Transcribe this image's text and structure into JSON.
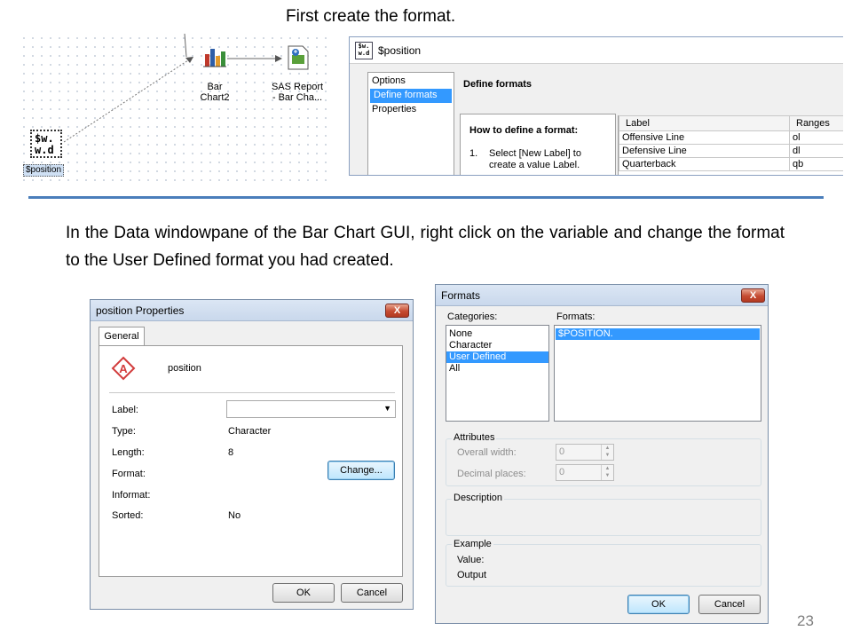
{
  "captions": {
    "top": "First create the format.",
    "middle": "In the Data windowpane of the Bar Chart GUI, right click on the variable and change the format to the User Defined format you had created."
  },
  "flow": {
    "node_format_icon_text": "$w.\nw.d",
    "node_format_label": "$position",
    "node_bar_label": "Bar\nChart2",
    "node_report_label": "SAS Report\n- Bar Cha..."
  },
  "format_window": {
    "title": "$position",
    "icon_text": "$w.\nw.d",
    "nav_items": [
      "Options",
      "Define formats",
      "Properties"
    ],
    "nav_selected": 1,
    "section_title": "Define formats",
    "howto_title": "How to define a format:",
    "howto_step_num": "1.",
    "howto_step_text": "Select [New Label] to\ncreate a value Label.",
    "grid_headers": [
      "Label",
      "Ranges"
    ],
    "grid_rows": [
      [
        "Offensive Line",
        "ol"
      ],
      [
        "Defensive Line",
        "dl"
      ],
      [
        "Quarterback",
        "qb"
      ]
    ]
  },
  "properties_dialog": {
    "title": "position Properties",
    "close_glyph": "X",
    "tab": "General",
    "var_name": "position",
    "fields": [
      {
        "label": "Label:",
        "value": ""
      },
      {
        "label": "Type:",
        "value": "Character"
      },
      {
        "label": "Length:",
        "value": "8"
      },
      {
        "label": "Format:",
        "value": ""
      },
      {
        "label": "Informat:",
        "value": ""
      },
      {
        "label": "Sorted:",
        "value": "No"
      }
    ],
    "change_button": "Change...",
    "ok_button": "OK",
    "cancel_button": "Cancel"
  },
  "formats_dialog": {
    "title": "Formats",
    "close_glyph": "X",
    "categories_label": "Categories:",
    "categories": [
      "None",
      "Character",
      "User Defined",
      "All"
    ],
    "categories_selected": 2,
    "formats_label": "Formats:",
    "formats": [
      "$POSITION."
    ],
    "formats_selected": 0,
    "attributes_title": "Attributes",
    "overall_width_label": "Overall width:",
    "overall_width_value": "0",
    "decimal_places_label": "Decimal places:",
    "decimal_places_value": "0",
    "description_title": "Description",
    "example_title": "Example",
    "value_label": "Value:",
    "output_label": "Output",
    "ok_button": "OK",
    "cancel_button": "Cancel"
  },
  "page_number": "23",
  "colors": {
    "selection": "#3399ff",
    "divider": "#4a7ebb",
    "close_button": "#c54a31"
  }
}
